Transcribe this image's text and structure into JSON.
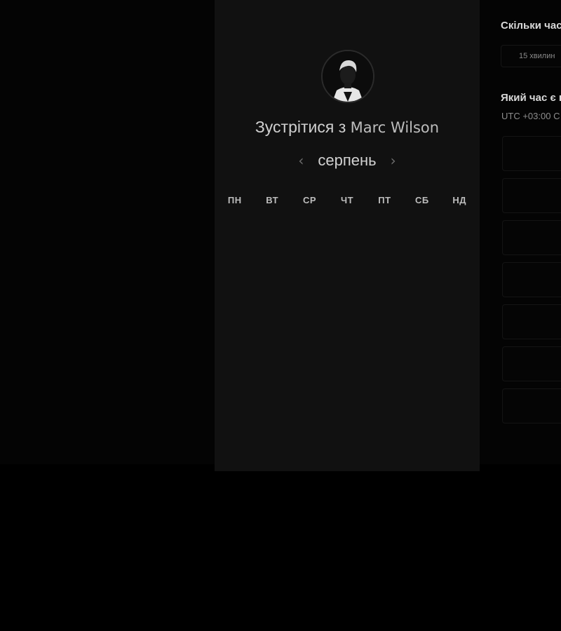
{
  "booking": {
    "title_prefix": "Зустрітися з",
    "host_name": "Marc Wilson",
    "month": "серпень",
    "prev_month_icon": "chevron-left-icon",
    "next_month_icon": "chevron-right-icon",
    "weekdays": [
      "ПН",
      "ВТ",
      "СР",
      "ЧТ",
      "ПТ",
      "СБ",
      "НД"
    ]
  },
  "scheduler": {
    "duration_question": "Скільки час",
    "duration_option": "15 хвилин",
    "time_question": "Який час є в",
    "timezone": "UTC +03:00 C",
    "slot_count": 7
  },
  "colors": {
    "page_bg": "#000000",
    "card_bg": "#111111",
    "text_primary": "#d2d2d2",
    "text_muted": "#8a8a8a"
  }
}
